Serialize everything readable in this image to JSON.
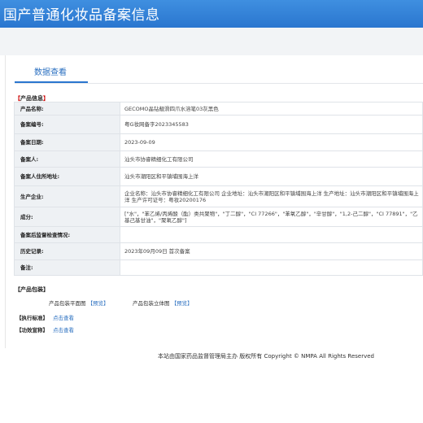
{
  "header": {
    "title": "国产普通化妆品备案信息"
  },
  "tab": {
    "label": "数据查看"
  },
  "product_info": {
    "heading_open": "【",
    "heading_text": "产品信息",
    "heading_close": "】",
    "rows": [
      {
        "label": "产品名称:",
        "value": "GECOMO晶钻靓滑四爪水溶笔03灰黑色"
      },
      {
        "label": "备案编号:",
        "value": "粤G妆网备字2023345583"
      },
      {
        "label": "备案日期:",
        "value": "2023-09-09"
      },
      {
        "label": "备案人:",
        "value": "汕头市协睿精细化工有限公司"
      },
      {
        "label": "备案人住所地址:",
        "value": "汕头市潮阳区和平镇埔围海上洋"
      },
      {
        "label": "生产企业:",
        "value": "企业名称：汕头市协睿精细化工有限公司 企业地址：汕头市潮阳区和平镇埔围海上洋 生产地址：汕头市潮阳区和平镇埔围海上洋 生产许可证号：粤妆20200176"
      },
      {
        "label": "成分:",
        "value": "[\"水\"，\"苯乙烯/丙烯酸（酯）类共聚物\"，\"丁二醇\"，\"CI 77266\"，\"苯氧乙醇\"，\"辛甘醇\"，\"1,2-己二醇\"，\"CI 77891\"，\"乙基己基甘油\"，\"聚氧乙醇\"]"
      },
      {
        "label": "备案后监督检查情况:",
        "value": ""
      },
      {
        "label": "历史记录:",
        "value": "2023年09月09日 首次备案"
      },
      {
        "label": "备注:",
        "value": ""
      }
    ]
  },
  "packaging": {
    "heading": "【产品包装】",
    "flat_label": "产品包装平面图",
    "flat_link": "【预览】",
    "solid_label": "产品包装立体图",
    "solid_link": "【预览】"
  },
  "standard": {
    "label": "【执行标准】",
    "link": "点击查看"
  },
  "claims": {
    "label": "【功效宣称】",
    "link": "点击查看"
  },
  "footer": {
    "text": "本站由国家药品监督管理局主办 版权所有 Copyright © NMPA All Rights Reserved"
  }
}
